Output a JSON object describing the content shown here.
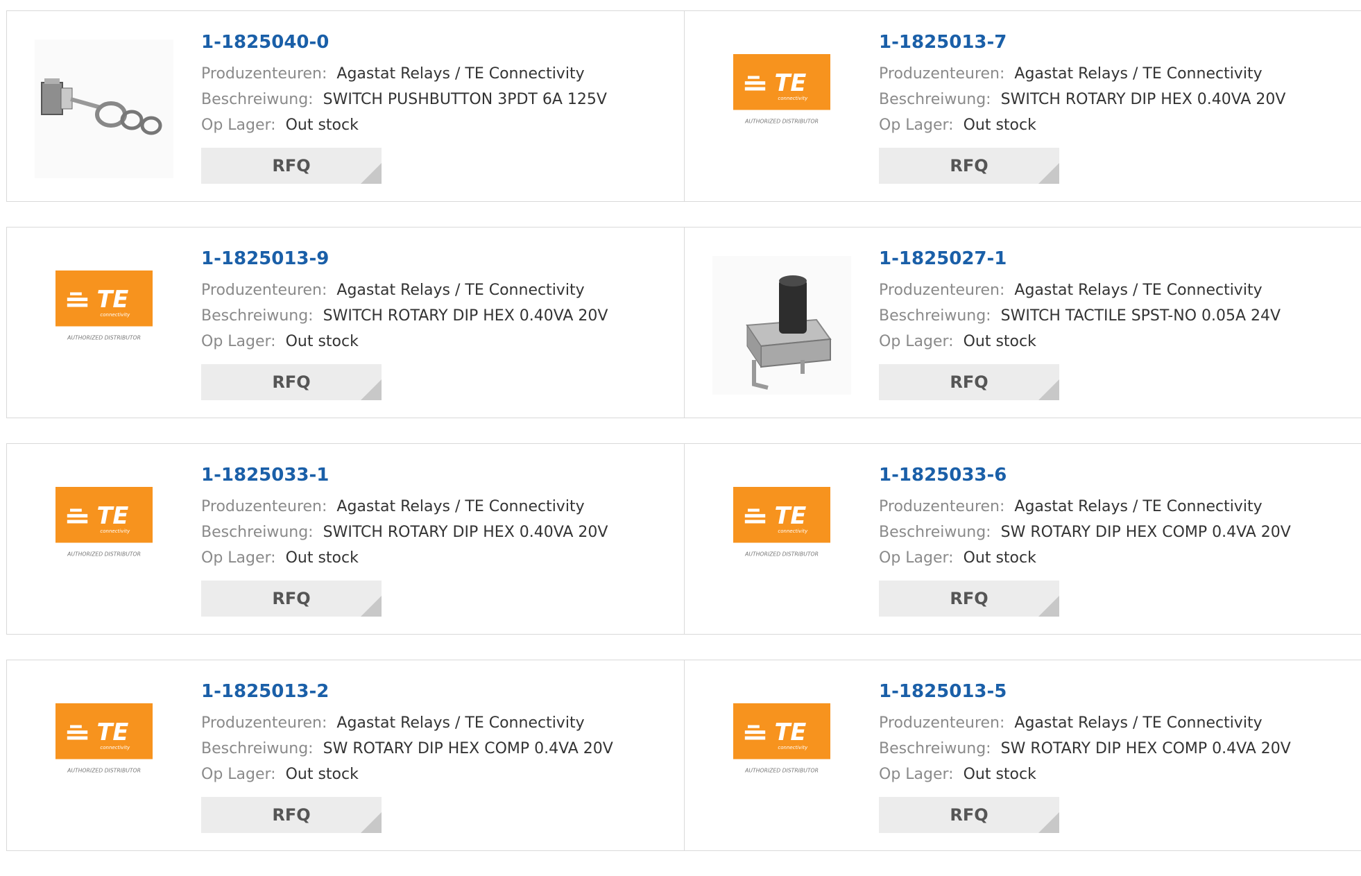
{
  "labels": {
    "manufacturer": "Produzenteuren:",
    "description": "Beschreiwung:",
    "stock": "Op Lager:",
    "rfq": "RFQ"
  },
  "logo": {
    "te_text": "TE",
    "te_sub": "connectivity",
    "distributor": "AUTHORIZED DISTRIBUTOR",
    "brand_color": "#f7931e"
  },
  "products": [
    {
      "part": "1-1825040-0",
      "manufacturer": "Agastat Relays / TE Connectivity",
      "description": "SWITCH PUSHBUTTON 3PDT 6A 125V",
      "stock": "Out stock",
      "image": "pushbutton-switch-photo"
    },
    {
      "part": "1-1825013-7",
      "manufacturer": "Agastat Relays / TE Connectivity",
      "description": "SWITCH ROTARY DIP HEX 0.40VA 20V",
      "stock": "Out stock",
      "image": "te-logo"
    },
    {
      "part": "1-1825013-9",
      "manufacturer": "Agastat Relays / TE Connectivity",
      "description": "SWITCH ROTARY DIP HEX 0.40VA 20V",
      "stock": "Out stock",
      "image": "te-logo"
    },
    {
      "part": "1-1825027-1",
      "manufacturer": "Agastat Relays / TE Connectivity",
      "description": "SWITCH TACTILE SPST-NO 0.05A 24V",
      "stock": "Out stock",
      "image": "tactile-switch-photo"
    },
    {
      "part": "1-1825033-1",
      "manufacturer": "Agastat Relays / TE Connectivity",
      "description": "SWITCH ROTARY DIP HEX 0.40VA 20V",
      "stock": "Out stock",
      "image": "te-logo"
    },
    {
      "part": "1-1825033-6",
      "manufacturer": "Agastat Relays / TE Connectivity",
      "description": "SW ROTARY DIP HEX COMP 0.4VA 20V",
      "stock": "Out stock",
      "image": "te-logo"
    },
    {
      "part": "1-1825013-2",
      "manufacturer": "Agastat Relays / TE Connectivity",
      "description": "SW ROTARY DIP HEX COMP 0.4VA 20V",
      "stock": "Out stock",
      "image": "te-logo"
    },
    {
      "part": "1-1825013-5",
      "manufacturer": "Agastat Relays / TE Connectivity",
      "description": "SW ROTARY DIP HEX COMP 0.4VA 20V",
      "stock": "Out stock",
      "image": "te-logo"
    }
  ]
}
